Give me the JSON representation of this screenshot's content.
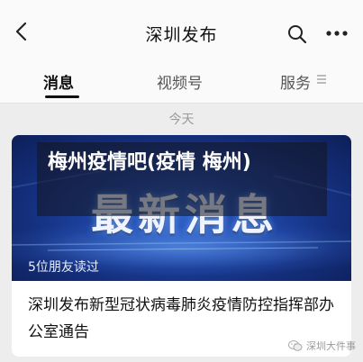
{
  "header": {
    "title": "深圳发布",
    "back_icon": "chevron-left-icon",
    "search_icon": "search-icon",
    "more_icon": "more-dots-icon"
  },
  "tabs": [
    {
      "label": "消息",
      "active": true
    },
    {
      "label": "视频号",
      "active": false
    },
    {
      "label": "服务",
      "active": false
    }
  ],
  "tab_menu_icon": "menu-lines-icon",
  "feed": {
    "date_label": "今天",
    "card": {
      "overlay_title": "梅州疫情吧(疫情 梅州)",
      "banner_text": "最新消息",
      "read_count": "5位朋友读过",
      "article_title": "深圳发布新型冠状病毒肺炎疫情防控指挥部办公室通告"
    }
  },
  "watermark": {
    "text": "深圳大件事",
    "logo_icon": "wechat-logo-icon"
  },
  "colors": {
    "background": "#ededed",
    "header_bg": "#fafafa",
    "banner_blue": "#1d44a3",
    "text_primary": "#111111",
    "text_muted": "#9a9a9a"
  }
}
